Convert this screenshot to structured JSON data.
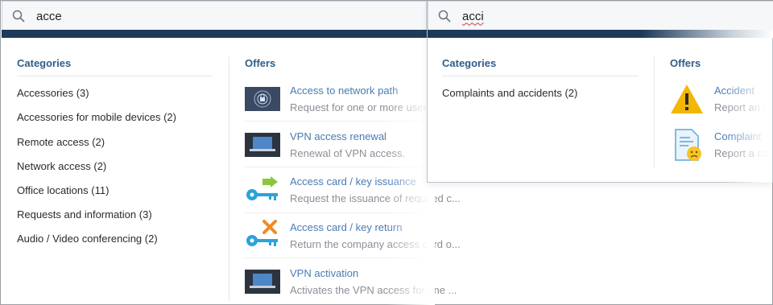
{
  "panel_a": {
    "query": "acce",
    "categories_title": "Categories",
    "offers_title": "Offers",
    "categories": [
      "Accessories (3)",
      "Accessories for mobile devices (2)",
      "Remote access (2)",
      "Network access (2)",
      "Office locations (11)",
      "Requests and information (3)",
      "Audio / Video conferencing (2)"
    ],
    "offers": [
      {
        "title": "Access to network path",
        "desc": "Request for one or more users",
        "icon": "network-lock-icon"
      },
      {
        "title": "VPN access renewal",
        "desc": "Renewal of VPN access.",
        "icon": "laptop-icon"
      },
      {
        "title": "Access card / key issuance",
        "desc": "Request the issuance of required c...",
        "icon": "key-arrow-icon"
      },
      {
        "title": "Access card / key return",
        "desc": "Return the company access card o...",
        "icon": "key-x-icon"
      },
      {
        "title": "VPN activation",
        "desc": "Activates the VPN access for one ...",
        "icon": "laptop-icon"
      }
    ]
  },
  "panel_b": {
    "query": "acci",
    "categories_title": "Categories",
    "offers_title": "Offers",
    "categories": [
      "Complaints and accidents (2)"
    ],
    "offers": [
      {
        "title": "Accident",
        "desc": "Report an i",
        "icon": "warning-icon"
      },
      {
        "title": "Complaint",
        "desc": "Report a cu",
        "icon": "complaint-document-icon"
      }
    ]
  },
  "colors": {
    "band": "#1e3a5a",
    "title_blue": "#2f5d8a",
    "offer_link": "#4a7bb0"
  }
}
